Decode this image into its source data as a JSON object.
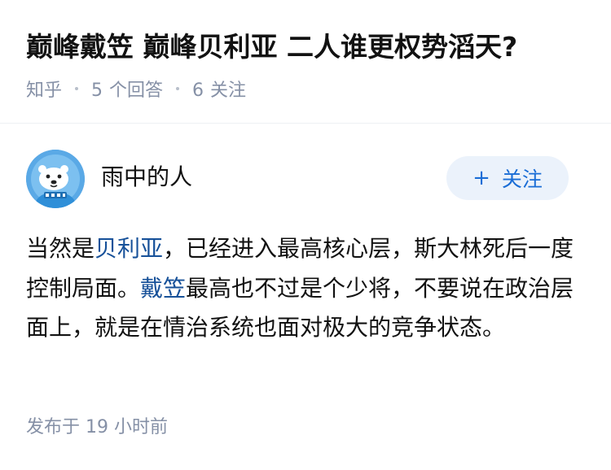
{
  "question": {
    "title": "巅峰戴笠 巅峰贝利亚 二人谁更权势滔天?",
    "meta": {
      "source": "知乎",
      "answer_count": "5",
      "answer_label": "个回答",
      "follower_count": "6",
      "follower_label": "关注"
    }
  },
  "answer": {
    "author": {
      "name": "雨中的人",
      "avatar_icon": "cartoon-bear-avatar-icon"
    },
    "follow_button": {
      "icon": "plus-icon",
      "plus_symbol": "+",
      "label": "关注"
    },
    "content": {
      "part1": "当然是",
      "link1": "贝利亚",
      "part2": "，已经进入最高核心层，斯大林死后一度控制局面。",
      "link2": "戴笠",
      "part3": "最高也不过是个少将，不要说在政治层面上，就是在情治系统也面对极大的竞争状态。"
    },
    "publish_label": "发布于",
    "publish_time": "19 小时前"
  },
  "colors": {
    "link": "#175199",
    "follow_accent": "#1a6dd6",
    "follow_bg": "#ebf2fb",
    "meta_text": "#8590a6",
    "avatar_bg": "#5aa9e6"
  }
}
